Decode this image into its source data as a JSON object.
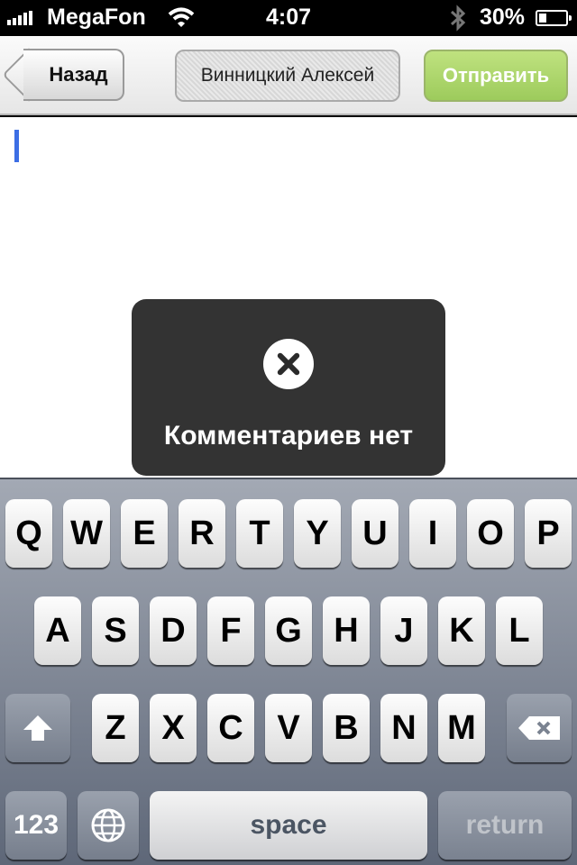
{
  "status_bar": {
    "carrier": "MegaFon",
    "time": "4:07",
    "battery_percent": "30%",
    "battery_level": 0.3,
    "icons": [
      "signal-icon",
      "wifi-icon",
      "bluetooth-icon",
      "battery-icon"
    ]
  },
  "nav": {
    "back_label": "Назад",
    "title": "Винницкий Алексей",
    "send_label": "Отправить",
    "send_color": "#a7d263"
  },
  "hud": {
    "message": "Комментариев нет",
    "icon": "close-circle-icon"
  },
  "keyboard": {
    "row1": [
      "Q",
      "W",
      "E",
      "R",
      "T",
      "Y",
      "U",
      "I",
      "O",
      "P"
    ],
    "row2": [
      "A",
      "S",
      "D",
      "F",
      "G",
      "H",
      "J",
      "K",
      "L"
    ],
    "row3": [
      "Z",
      "X",
      "C",
      "V",
      "B",
      "N",
      "M"
    ],
    "numbers_label": "123",
    "space_label": "space",
    "return_label": "return"
  }
}
